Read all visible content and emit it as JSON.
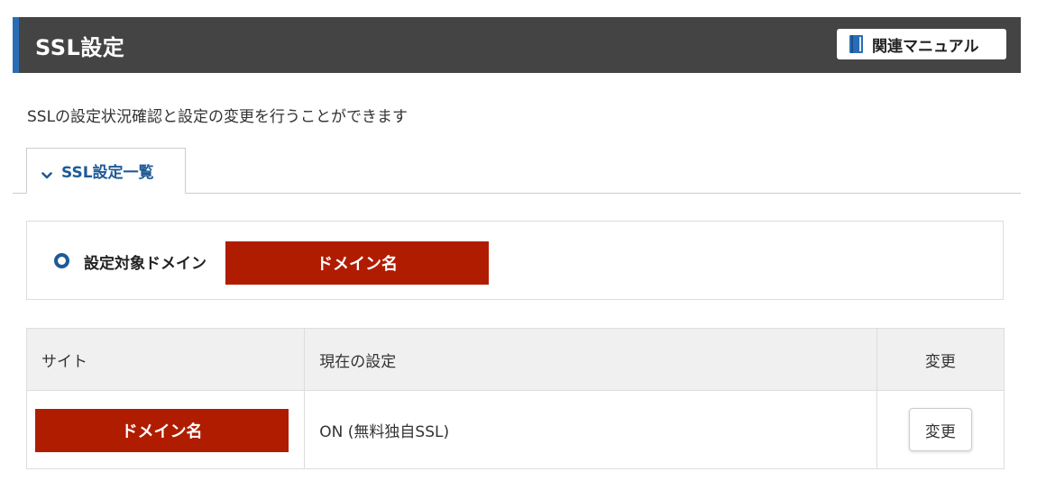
{
  "header": {
    "title": "SSL設定",
    "manual_button_label": "関連マニュアル",
    "manual_icon": "book-icon"
  },
  "description": "SSLの設定状況確認と設定の変更を行うことができます",
  "tabs": [
    {
      "label": "SSL設定一覧",
      "icon": "chevron-down-icon",
      "active": true
    }
  ],
  "domain_selector": {
    "label": "設定対象ドメイン",
    "value": "ドメイン名"
  },
  "table": {
    "columns": [
      "サイト",
      "現在の設定",
      "変更"
    ],
    "rows": [
      {
        "site": "ドメイン名",
        "current": "ON (無料独自SSL)",
        "action_label": "変更"
      }
    ]
  },
  "colors": {
    "header_bg": "#444444",
    "header_accent": "#2a6db5",
    "link_blue": "#1f5a96",
    "redaction_red": "#b01c00"
  }
}
